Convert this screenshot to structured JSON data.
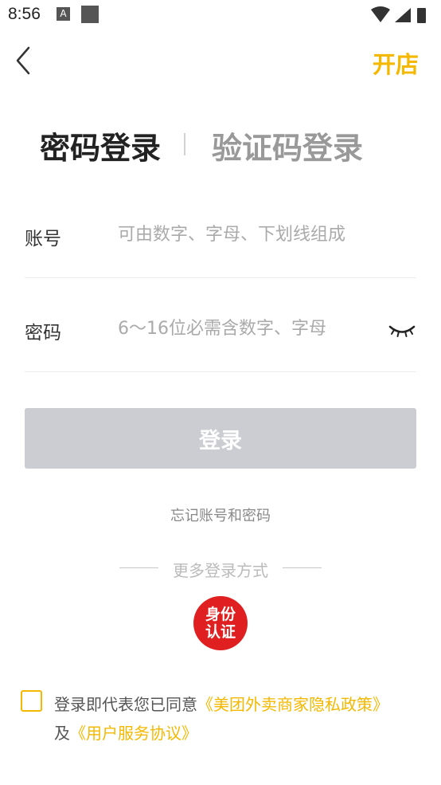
{
  "status_bar": {
    "time": "8:56",
    "a_icon_label": "A"
  },
  "header": {
    "open_shop": "开店"
  },
  "tabs": {
    "active": "密码登录",
    "inactive": "验证码登录"
  },
  "account": {
    "label": "账号",
    "placeholder": "可由数字、字母、下划线组成"
  },
  "password": {
    "label": "密码",
    "placeholder": "6～16位必需含数字、字母"
  },
  "login_button": "登录",
  "forgot_link": "忘记账号和密码",
  "more_login": "更多登录方式",
  "id_auth": {
    "line1": "身份",
    "line2": "认证"
  },
  "agreement": {
    "prefix": "登录即代表您已同意",
    "privacy_link": "《美团外卖商家隐私政策》",
    "and": "及",
    "service_link": "《用户服务协议》"
  },
  "colors": {
    "accent": "#f5b800",
    "button_disabled": "#cccdd2",
    "id_badge": "#e02020"
  }
}
